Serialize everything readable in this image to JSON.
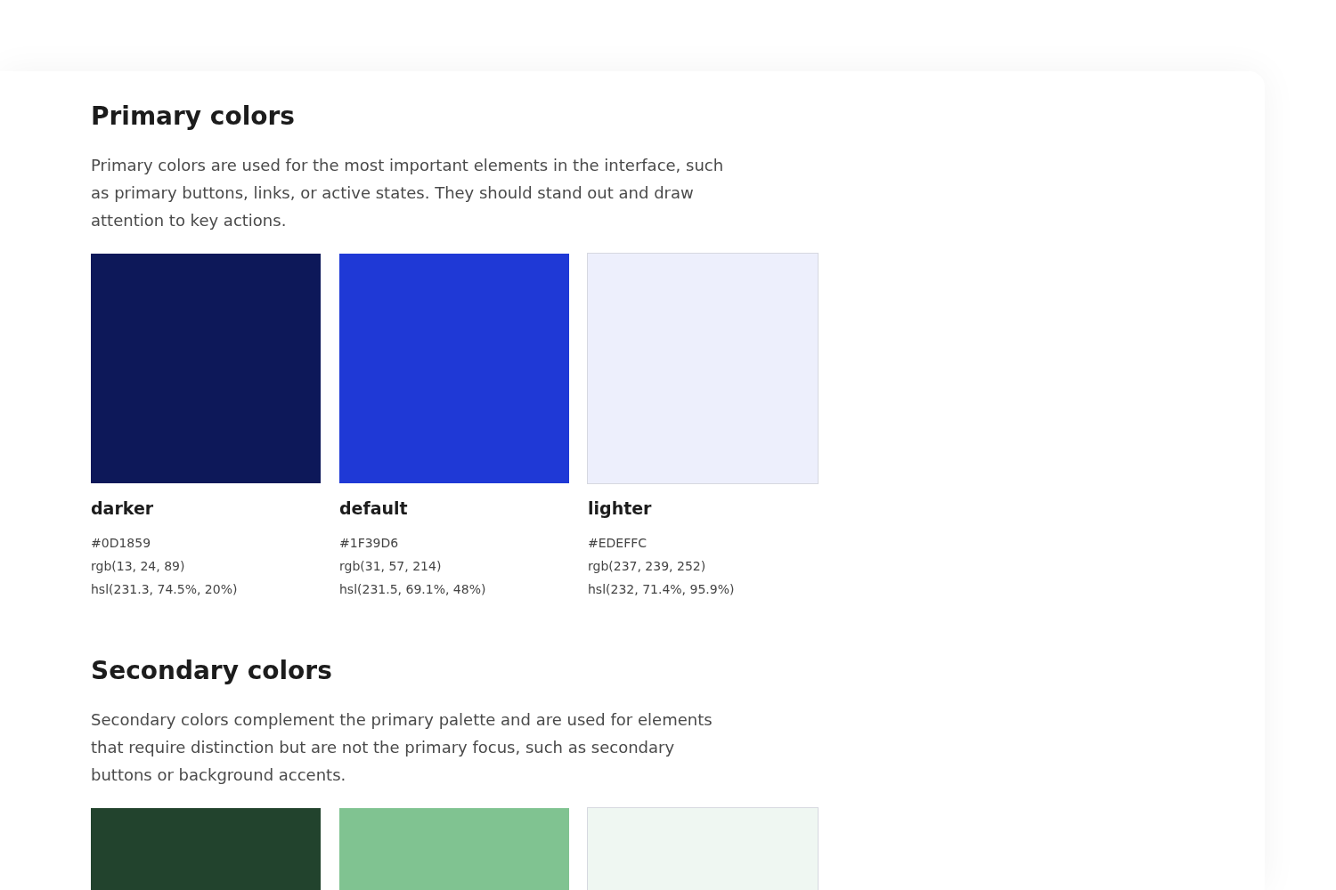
{
  "sections": [
    {
      "title": "Primary colors",
      "description": "Primary colors are used for the most important elements in the interface, such as primary buttons, links, or active states. They should stand out and draw attention to key actions.",
      "swatches": [
        {
          "name": "darker",
          "color": "#0d1859",
          "hex": "#0D1859",
          "rgb": "rgb(13, 24, 89)",
          "hsl": "hsl(231.3, 74.5%, 20%)"
        },
        {
          "name": "default",
          "color": "#1f39d6",
          "hex": "#1F39D6",
          "rgb": "rgb(31, 57, 214)",
          "hsl": "hsl(231.5, 69.1%, 48%)"
        },
        {
          "name": "lighter",
          "color": "#edeffc",
          "hex": "#EDEFFC",
          "rgb": "rgb(237, 239, 252)",
          "hsl": "hsl(232, 71.4%, 95.9%)"
        }
      ]
    },
    {
      "title": "Secondary colors",
      "description": "Secondary colors complement the primary palette and are used for elements that require distinction but are not the primary focus, such as secondary buttons or background accents.",
      "swatches": [
        {
          "color": "#22432d"
        },
        {
          "color": "#80c391"
        },
        {
          "color": "#eff7f2"
        }
      ]
    }
  ]
}
